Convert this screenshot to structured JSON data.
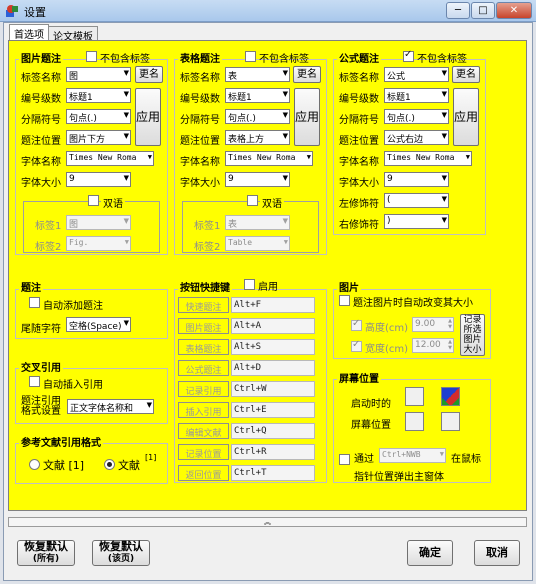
{
  "window": {
    "title": "设置",
    "minimize": "─",
    "maximize": "□",
    "close": "✕"
  },
  "tabs": [
    "首选项",
    "论文模板"
  ],
  "figure_caption": {
    "title": "图片题注",
    "exclude_label": "不包含标签",
    "exclude_checked": false,
    "label_name_label": "标签名称",
    "label_name_value": "图",
    "rename_button": "更名",
    "numbering_label": "编号级数",
    "numbering_value": "标题1",
    "separator_label": "分隔符号",
    "separator_value": "句点(.)",
    "position_label": "题注位置",
    "position_value": "图片下方",
    "apply_button": "应用",
    "font_label": "字体名称",
    "font_value": "Times New Roma",
    "size_label": "字体大小",
    "size_value": "9",
    "bilingual_label": "双语",
    "bilingual_checked": false,
    "label1_label": "标签1",
    "label1_value": "图",
    "label2_label": "标签2",
    "label2_value": "Fig."
  },
  "table_caption": {
    "title": "表格题注",
    "exclude_label": "不包含标签",
    "exclude_checked": false,
    "label_name_label": "标签名称",
    "label_name_value": "表",
    "rename_button": "更名",
    "numbering_label": "编号级数",
    "numbering_value": "标题1",
    "separator_label": "分隔符号",
    "separator_value": "句点(.)",
    "position_label": "题注位置",
    "position_value": "表格上方",
    "apply_button": "应用",
    "font_label": "字体名称",
    "font_value": "Times New Roma",
    "size_label": "字体大小",
    "size_value": "9",
    "bilingual_label": "双语",
    "bilingual_checked": false,
    "label1_label": "标签1",
    "label1_value": "表",
    "label2_label": "标签2",
    "label2_value": "Table"
  },
  "formula_caption": {
    "title": "公式题注",
    "exclude_label": "不包含标签",
    "exclude_checked": true,
    "label_name_label": "标签名称",
    "label_name_value": "公式",
    "rename_button": "更名",
    "numbering_label": "编号级数",
    "numbering_value": "标题1",
    "separator_label": "分隔符号",
    "separator_value": "句点(.)",
    "position_label": "题注位置",
    "position_value": "公式右边",
    "apply_button": "应用",
    "font_label": "字体名称",
    "font_value": "Times New Roma",
    "size_label": "字体大小",
    "size_value": "9",
    "left_label": "左修饰符",
    "left_value": "(",
    "right_label": "右修饰符",
    "right_value": ")"
  },
  "caption": {
    "title": "题注",
    "auto_add_label": "自动添加题注",
    "auto_add_checked": false,
    "tail_label": "尾随字符",
    "tail_value": "空格(Space)"
  },
  "cross_ref": {
    "title": "交叉引用",
    "auto_insert_label": "自动插入引用",
    "auto_insert_checked": false,
    "format_label_1": "题注引用",
    "format_label_2": "格式设置",
    "format_value": "正文字体名称和"
  },
  "ref_format": {
    "title": "参考文献引用格式",
    "opt1_text": "文献 [1]",
    "opt1_selected": false,
    "opt2_text": "文献",
    "opt2_sup": "[1]",
    "opt2_selected": true
  },
  "hotkeys": {
    "title": "按钮快捷键",
    "enable_label": "启用",
    "enable_checked": false,
    "items": [
      {
        "label": "快速题注",
        "key": "Alt+F"
      },
      {
        "label": "图片题注",
        "key": "Alt+A"
      },
      {
        "label": "表格题注",
        "key": "Alt+S"
      },
      {
        "label": "公式题注",
        "key": "Alt+D"
      },
      {
        "label": "记录引用",
        "key": "Ctrl+W"
      },
      {
        "label": "插入引用",
        "key": "Ctrl+E"
      },
      {
        "label": "编辑文献",
        "key": "Ctrl+Q"
      },
      {
        "label": "记录位置",
        "key": "Ctrl+R"
      },
      {
        "label": "返回位置",
        "key": "Ctrl+T"
      }
    ]
  },
  "picture": {
    "title": "图片",
    "auto_resize_label": "题注图片时自动改变其大小",
    "auto_resize_checked": false,
    "height_label": "高度(cm)",
    "height_checked": true,
    "height_value": "9.00",
    "width_label": "宽度(cm)",
    "width_checked": true,
    "width_value": "12.00",
    "record_button_1": "记录",
    "record_button_2": "所选",
    "record_button_3": "图片",
    "record_button_4": "大小"
  },
  "screen_pos": {
    "title": "屏幕位置",
    "start_label_1": "启动时的",
    "start_label_2": "屏幕位置",
    "via_label": "通过",
    "via_value": "Ctrl+NWB",
    "mouse_label": "在鼠标",
    "popup_label": "指针位置弹出主窗体",
    "via_checked": false
  },
  "collapse_glyph": "︽",
  "footer": {
    "restore_all_1": "恢复默认",
    "restore_all_2": "(所有)",
    "restore_cur_1": "恢复默认",
    "restore_cur_2": "(该页)",
    "ok": "确定",
    "cancel": "取消"
  },
  "colors": {
    "panel_bg": "#ffff00",
    "title_bg": "#b7d2f0",
    "close_red": "#c8442b"
  },
  "icons": [
    "app-icon",
    "collapse-chevron-icon",
    "screen-position-grid-icon"
  ]
}
